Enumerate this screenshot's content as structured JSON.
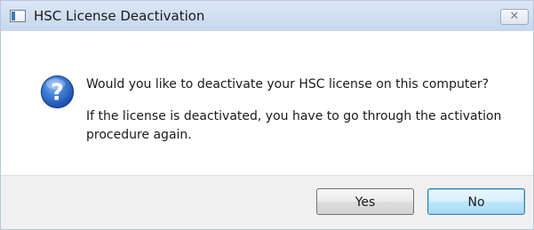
{
  "window": {
    "title": "HSC License Deactivation",
    "close_glyph": "✕"
  },
  "message": {
    "icon": "question-icon",
    "primary": "Would you like to deactivate your HSC license on this computer?",
    "secondary": "If the license is deactivated, you have to go through the activation procedure again."
  },
  "buttons": {
    "yes_label": "Yes",
    "no_label": "No"
  },
  "colors": {
    "titlebar": "#cfdef1",
    "footer": "#f0f0f0",
    "default_button_border": "#3c7fb1",
    "icon_blue": "#2a64c0"
  }
}
